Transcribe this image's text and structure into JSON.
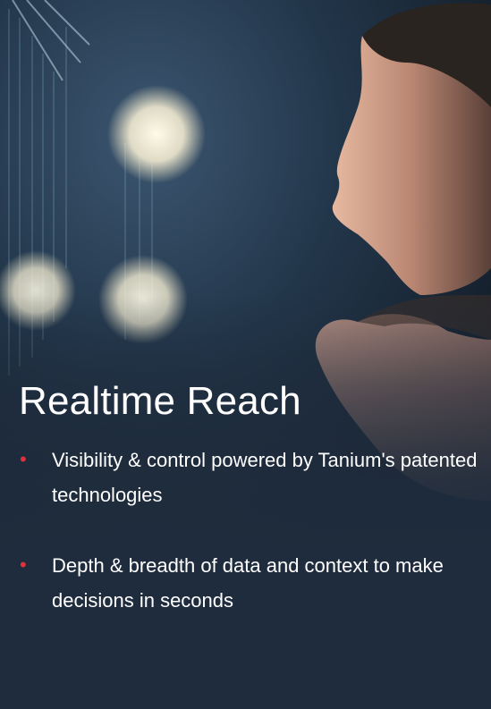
{
  "slide": {
    "title": "Realtime Reach",
    "bullets": [
      {
        "text": "Visibility & control powered by Tanium's patented technologies"
      },
      {
        "text": "Depth & breadth of data and context to make decisions in seconds"
      }
    ],
    "bullet_glyph": "•"
  },
  "colors": {
    "background": "#1f2c3d",
    "bullet_accent": "#e0303a",
    "text": "#ffffff"
  }
}
